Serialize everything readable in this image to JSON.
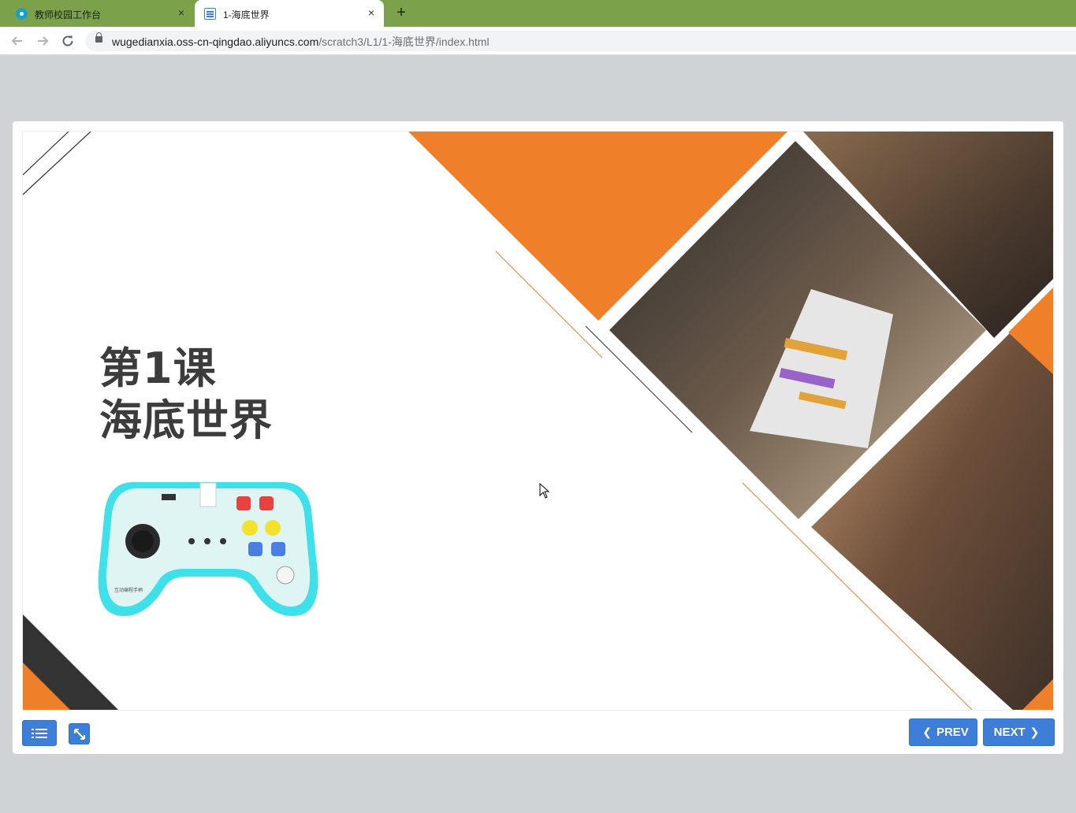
{
  "browser": {
    "tabs": [
      {
        "title": "教师校园工作台",
        "active": false
      },
      {
        "title": "1-海底世界",
        "active": true
      }
    ],
    "new_tab": "+",
    "close_glyph": "×",
    "url_host": "wugedianxia.oss-cn-qingdao.aliyuncs.com",
    "url_path": "/scratch3/L1/1-海底世界/index.html",
    "icons": {
      "back": "arrow-left-icon",
      "forward": "arrow-right-icon",
      "reload": "reload-icon",
      "lock": "lock-icon"
    }
  },
  "slide": {
    "title_line1": "第1课",
    "title_line2": "海底世界",
    "gamepad_label": "互动编程手柄",
    "colors": {
      "accent_orange": "#f07f2a",
      "dark": "#333333",
      "controller_cyan": "#3ee0ea"
    }
  },
  "controls": {
    "prev_label": "PREV",
    "next_label": "NEXT",
    "button_color": "#3d7fd8",
    "icons": {
      "menu": "list-icon",
      "fullscreen": "expand-icon",
      "prev": "chevron-left-icon",
      "next": "chevron-right-icon"
    }
  }
}
